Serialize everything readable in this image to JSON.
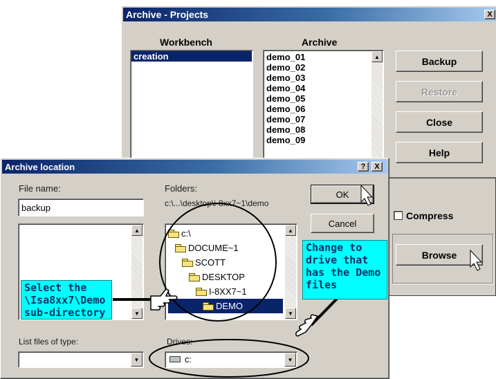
{
  "archive_projects": {
    "title": "Archive - Projects",
    "close_glyph": "X",
    "workbench_header": "Workbench",
    "archive_header": "Archive",
    "workbench_items": [
      "creation"
    ],
    "archive_items": [
      "demo_01",
      "demo_02",
      "demo_03",
      "demo_04",
      "demo_05",
      "demo_06",
      "demo_07",
      "demo_08",
      "demo_09"
    ],
    "buttons": {
      "backup": "Backup",
      "restore": "Restore",
      "close": "Close",
      "help": "Help",
      "browse": "Browse"
    },
    "compress_label": "Compress"
  },
  "archive_location": {
    "title": "Archive location",
    "help_glyph": "?",
    "close_glyph": "X",
    "file_name_label": "File name:",
    "file_name_value": "backup",
    "folders_label": "Folders:",
    "folders_path": "c:\\...\\desktop\\i-8xx7~1\\demo",
    "ok_label": "OK",
    "cancel_label": "Cancel",
    "tree": [
      "c:\\",
      "DOCUME~1",
      "SCOTT",
      "DESKTOP",
      "I-8XX7~1",
      "DEMO"
    ],
    "list_type_label": "List files of type:",
    "drives_label": "Drives:",
    "drive_value": "c:"
  },
  "annotations": {
    "select_demo": "Select the \\Isa8xx7\\Demo sub-directory",
    "change_drive": "Change to drive that has the Demo files"
  },
  "colors": {
    "titlebar": "#0a246a",
    "selection": "#0a246a",
    "callout": "#00ffff",
    "callout_text": "#003366",
    "dialog": "#d4d0c8"
  }
}
